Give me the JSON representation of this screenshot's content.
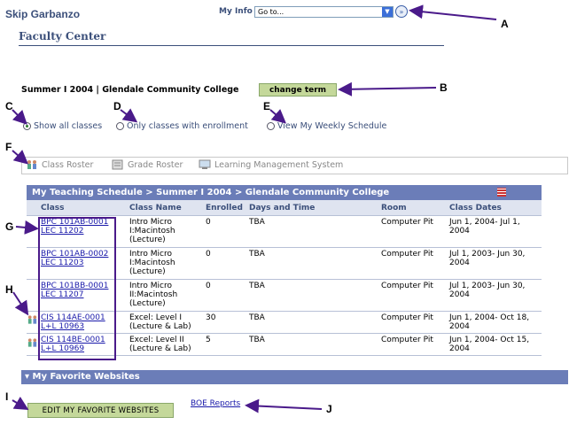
{
  "header": {
    "user_name": "Skip Garbanzo",
    "my_info_label": "My Info",
    "goto_value": "Go to...",
    "page_title": "Faculty Center"
  },
  "term": {
    "text": "Summer I 2004 | Glendale Community College",
    "change_label": "change term"
  },
  "filters": [
    {
      "label": "Show all classes",
      "selected": true
    },
    {
      "label": "Only classes with enrollment",
      "selected": false
    },
    {
      "label": "View My Weekly Schedule",
      "selected": false
    }
  ],
  "tools": [
    {
      "label": "Class Roster",
      "icon": "roster-icon"
    },
    {
      "label": "Grade Roster",
      "icon": "grade-roster-icon"
    },
    {
      "label": "Learning Management System",
      "icon": "lms-icon"
    }
  ],
  "schedule": {
    "title": "My Teaching Schedule > Summer I 2004 > Glendale Community College",
    "columns": [
      "Class",
      "Class Name",
      "Enrolled",
      "Days and Time",
      "Room",
      "Class Dates"
    ],
    "rows": [
      {
        "class_line1": "BPC 101AB-0001",
        "class_line2": "LEC 11202",
        "name": "Intro Micro I:Macintosh (Lecture)",
        "enrolled": "0",
        "days": "TBA",
        "room": "Computer Pit",
        "dates": "Jun 1, 2004- Jul 1, 2004",
        "roster": false
      },
      {
        "class_line1": "BPC 101AB-0002",
        "class_line2": "LEC 11203",
        "name": "Intro Micro I:Macintosh (Lecture)",
        "enrolled": "0",
        "days": "TBA",
        "room": "Computer Pit",
        "dates": "Jul 1, 2003- Jun 30, 2004",
        "roster": false
      },
      {
        "class_line1": "BPC 101BB-0001",
        "class_line2": "LEC 11207",
        "name": "Intro Micro II:Macintosh (Lecture)",
        "enrolled": "0",
        "days": "TBA",
        "room": "Computer Pit",
        "dates": "Jul 1, 2003- Jun 30, 2004",
        "roster": false
      },
      {
        "class_line1": "CIS 114AE-0001",
        "class_line2": "L+L 10963",
        "name": "Excel: Level I (Lecture & Lab)",
        "enrolled": "30",
        "days": "TBA",
        "room": "Computer Pit",
        "dates": "Jun 1, 2004- Oct 18, 2004",
        "roster": true
      },
      {
        "class_line1": "CIS 114BE-0001",
        "class_line2": "L+L 10969",
        "name": "Excel: Level II (Lecture & Lab)",
        "enrolled": "5",
        "days": "TBA",
        "room": "Computer Pit",
        "dates": "Jun 1, 2004- Oct 15, 2004",
        "roster": true
      }
    ]
  },
  "favorites": {
    "title": "My Favorite Websites",
    "edit_label": "Edit My Favorite Websites",
    "link": "BOE Reports"
  },
  "callouts": [
    "A",
    "B",
    "C",
    "D",
    "E",
    "F",
    "G",
    "H",
    "I",
    "J"
  ],
  "colors": {
    "header_blue": "#6b7db8",
    "title_blue": "#3b4f7a",
    "button_green": "#c4d89a",
    "callout_arrow": "#4a1a8a"
  }
}
